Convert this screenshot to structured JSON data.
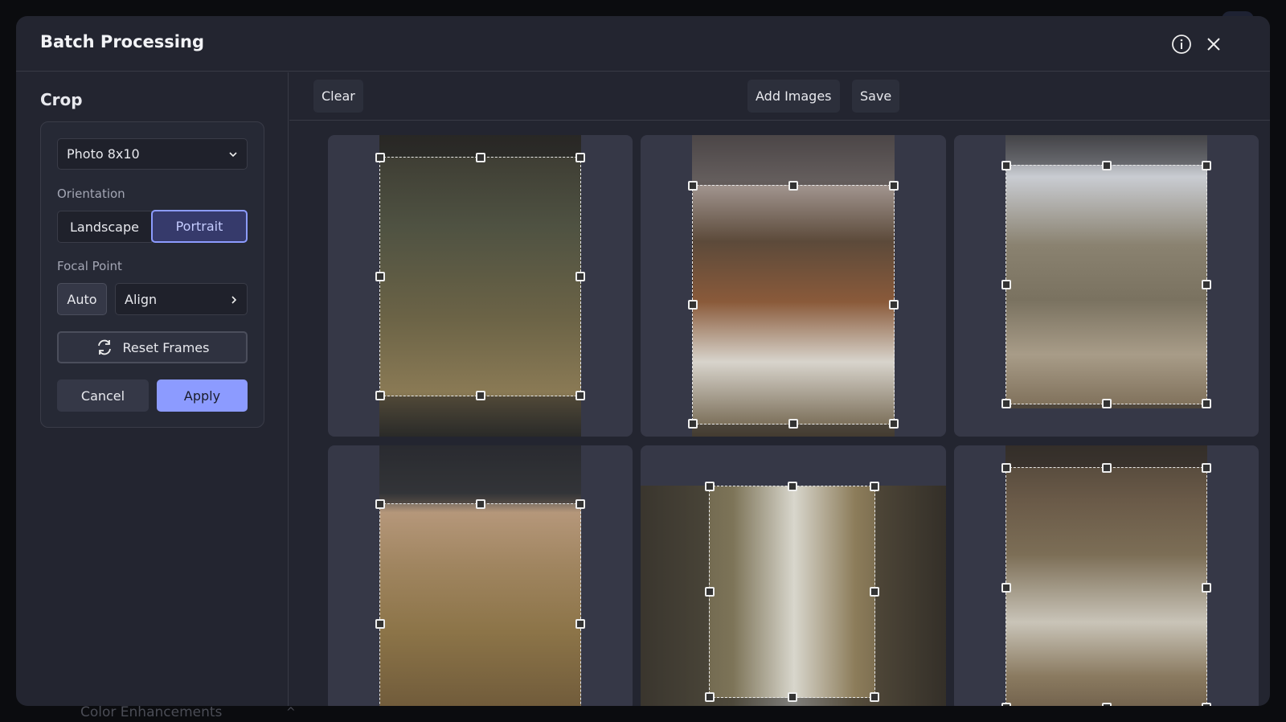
{
  "modal": {
    "title": "Batch Processing"
  },
  "sidebar": {
    "section_title": "Crop",
    "preset": "Photo 8x10",
    "orientation_label": "Orientation",
    "orientation_options": [
      "Landscape",
      "Portrait"
    ],
    "orientation_selected": "Portrait",
    "focal_label": "Focal Point",
    "focal_auto": "Auto",
    "focal_align": "Align",
    "reset_label": "Reset Frames",
    "cancel_label": "Cancel",
    "apply_label": "Apply"
  },
  "toolbar": {
    "clear": "Clear",
    "add_images": "Add Images",
    "save": "Save"
  },
  "background": {
    "footer_label": "Color Enhancements"
  },
  "colors": {
    "accent": "#8c9bff",
    "selected_bg": "#363a6b",
    "modal_bg": "#232530",
    "card_bg": "#363847"
  }
}
